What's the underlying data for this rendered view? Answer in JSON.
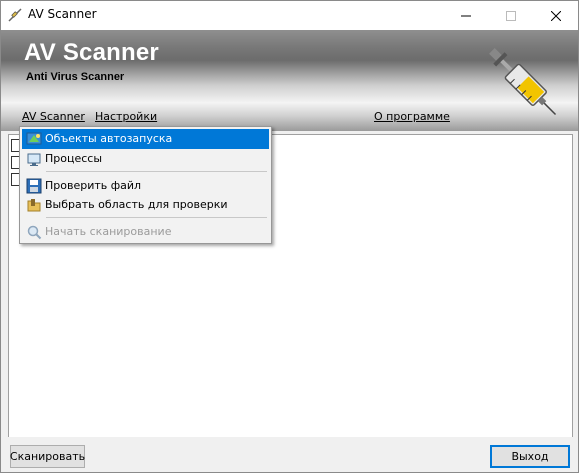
{
  "window": {
    "title": "AV Scanner",
    "icon": "syringe-icon"
  },
  "banner": {
    "title": "AV Scanner",
    "subtitle": "Anti Virus Scanner"
  },
  "menubar": {
    "items": [
      "AV Scanner",
      "Настройки",
      "О программе"
    ]
  },
  "popup_menu": {
    "items": [
      {
        "label": "Объекты автозапуска",
        "icon": "startup-objects-icon",
        "selected": true,
        "enabled": true
      },
      {
        "label": "Процессы",
        "icon": "processes-icon",
        "selected": false,
        "enabled": true
      },
      {
        "label": "Проверить файл",
        "icon": "floppy-disk-icon",
        "selected": false,
        "enabled": true
      },
      {
        "label": "Выбрать область для проверки",
        "icon": "folder-icon",
        "selected": false,
        "enabled": true
      },
      {
        "label": "Начать сканирование",
        "icon": "magnifier-icon",
        "selected": false,
        "enabled": false
      }
    ]
  },
  "content": {
    "checkbox_count": 3
  },
  "buttons": {
    "scan": "Сканировать",
    "exit": "Выход"
  },
  "colors": {
    "selection": "#0078d7",
    "banner_title": "#ffffff"
  }
}
